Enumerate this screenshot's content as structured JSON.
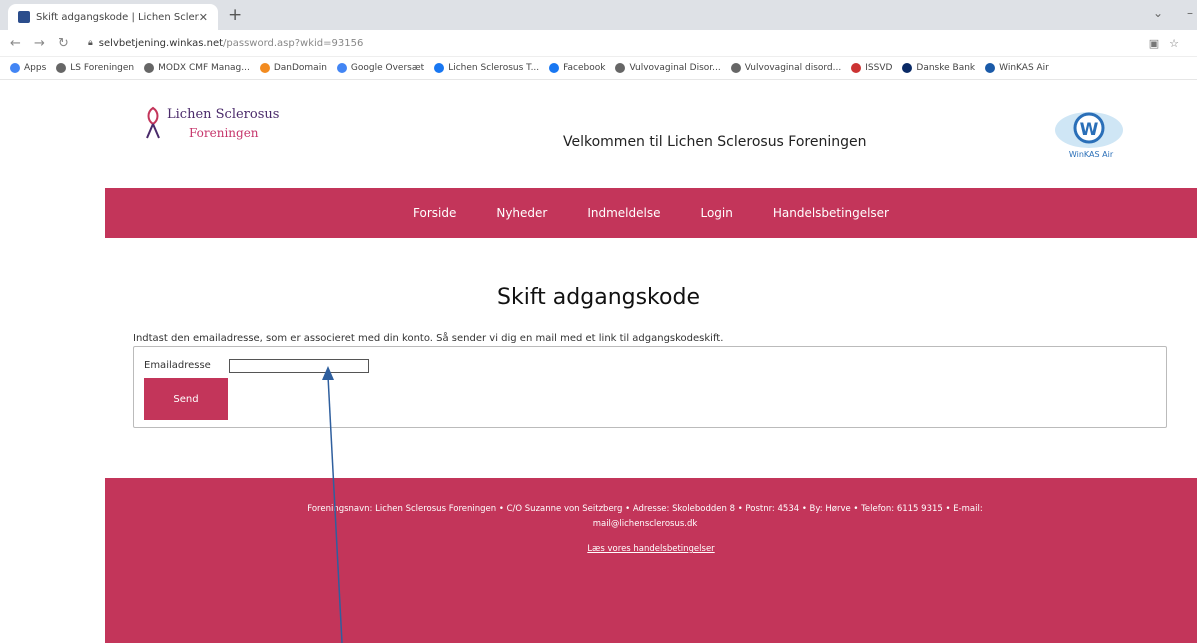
{
  "browser": {
    "tab_title": "Skift adgangskode | Lichen Scler...",
    "url_host": "selvbetjening.winkas.net",
    "url_path": "/password.asp?wkid=93156",
    "bookmarks": [
      {
        "label": "Apps",
        "color": "#4285f4"
      },
      {
        "label": "LS Foreningen",
        "color": "#666666"
      },
      {
        "label": "MODX CMF Manag...",
        "color": "#666666"
      },
      {
        "label": "DanDomain",
        "color": "#f28b20"
      },
      {
        "label": "Google Oversæt",
        "color": "#4285f4"
      },
      {
        "label": "Lichen Sclerosus T...",
        "color": "#1877f2"
      },
      {
        "label": "Facebook",
        "color": "#1877f2"
      },
      {
        "label": "Vulvovaginal Disor...",
        "color": "#666666"
      },
      {
        "label": "Vulvovaginal disord...",
        "color": "#666666"
      },
      {
        "label": "ISSVD",
        "color": "#cc3333"
      },
      {
        "label": "Danske Bank",
        "color": "#0a2a66"
      },
      {
        "label": "WinKAS Air",
        "color": "#1a5aa8"
      }
    ]
  },
  "header": {
    "logo_line1": "Lichen Sclerosus",
    "logo_line2": "Foreningen",
    "welcome": "Velkommen til Lichen Sclerosus Foreningen",
    "right_logo_text": "WinKAS Air"
  },
  "nav": [
    "Forside",
    "Nyheder",
    "Indmeldelse",
    "Login",
    "Handelsbetingelser"
  ],
  "main": {
    "title": "Skift adgangskode",
    "instructions": "Indtast den emailadresse, som er associeret med din konto. Så sender vi dig en mail med et link til adgangskodeskift.",
    "email_label": "Emailadresse",
    "email_value": "",
    "send_label": "Send"
  },
  "footer": {
    "info_line1": "Foreningsnavn: Lichen Sclerosus Foreningen • C/O Suzanne von Seitzberg • Adresse: Skolebodden 8 • Postnr: 4534 • By: Hørve • Telefon: 6115 9315 • E-mail:",
    "info_line2": "mail@lichensclerosus.dk",
    "terms_link": "Læs vores handelsbetingelser"
  },
  "colors": {
    "brand": "#c3355a",
    "arrow": "#2f5f9e"
  }
}
